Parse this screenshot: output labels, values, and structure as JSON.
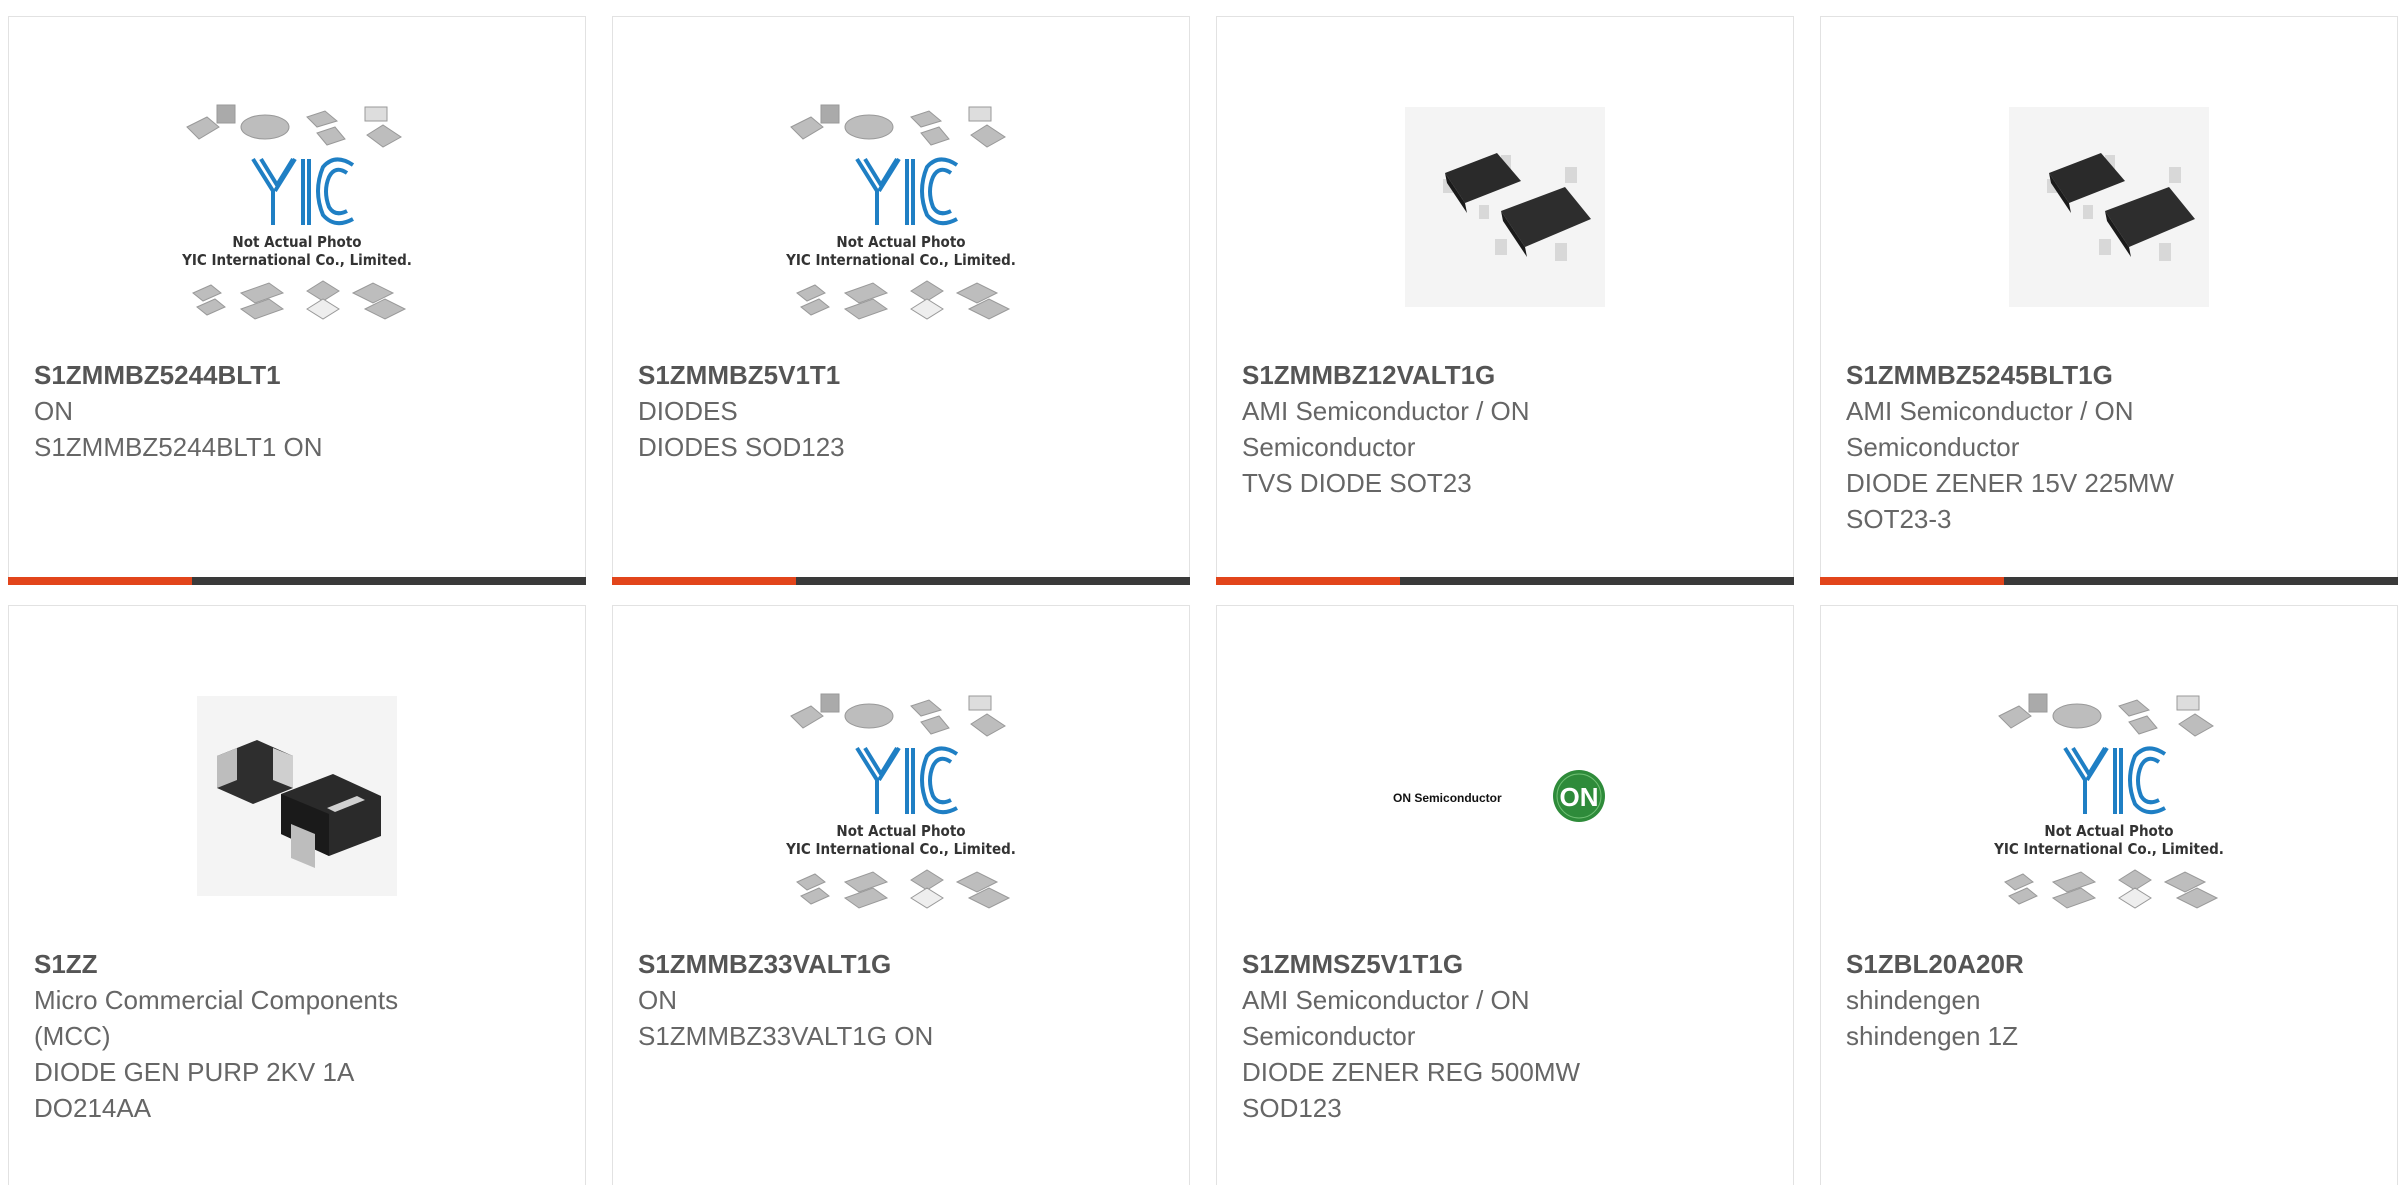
{
  "products": [
    {
      "part": "S1ZMMBZ5244BLT1",
      "lines": [
        "ON",
        "S1ZMMBZ5244BLT1 ON"
      ],
      "image": "yic-placeholder-image"
    },
    {
      "part": "S1ZMMBZ5V1T1",
      "lines": [
        "DIODES",
        "DIODES SOD123"
      ],
      "image": "yic-placeholder-image"
    },
    {
      "part": "S1ZMMBZ12VALT1G",
      "lines": [
        "AMI Semiconductor / ON",
        "Semiconductor",
        "TVS DIODE SOT23"
      ],
      "image": "sot23-package-image"
    },
    {
      "part": "S1ZMMBZ5245BLT1G",
      "lines": [
        "AMI Semiconductor / ON",
        "Semiconductor",
        "DIODE ZENER 15V 225MW",
        "SOT23-3"
      ],
      "image": "sot23-package-image"
    },
    {
      "part": "S1ZZ",
      "lines": [
        "Micro Commercial Components",
        "(MCC)",
        "DIODE GEN PURP 2KV 1A",
        "DO214AA"
      ],
      "image": "smd-diode-package-image"
    },
    {
      "part": "S1ZMMBZ33VALT1G",
      "lines": [
        "ON",
        "S1ZMMBZ33VALT1G ON"
      ],
      "image": "yic-placeholder-image"
    },
    {
      "part": "S1ZMMSZ5V1T1G",
      "lines": [
        "AMI Semiconductor / ON",
        "Semiconductor",
        "DIODE ZENER REG 500MW",
        "SOD123"
      ],
      "image": "on-semiconductor-logo"
    },
    {
      "part": "S1ZBL20A20R",
      "lines": [
        "shindengen",
        "shindengen 1Z"
      ],
      "image": "yic-placeholder-image"
    }
  ],
  "placeholder": {
    "logo_text": "YIC",
    "caption_1": "Not Actual Photo",
    "caption_2": "YIC International Co., Limited."
  },
  "on_logo": {
    "wordmark": "ON Semiconductor",
    "badge": "ON",
    "badge_color": "#2e8b3a"
  },
  "colors": {
    "accent": "#e2451b",
    "bar": "#3a3a3a",
    "logo_blue": "#1f7fc4"
  }
}
